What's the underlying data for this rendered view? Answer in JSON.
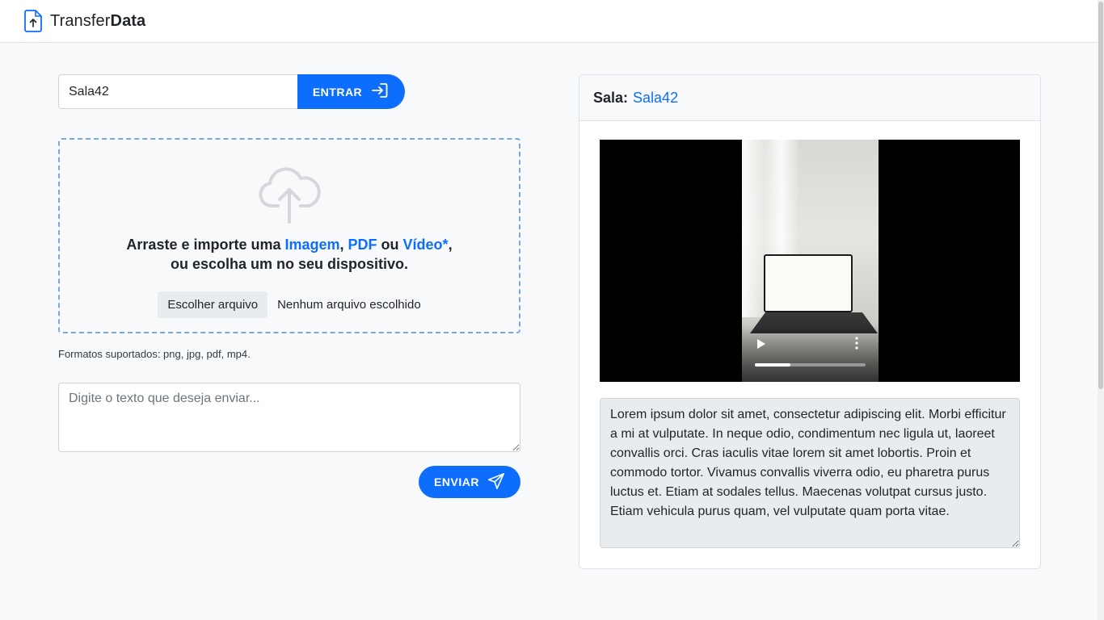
{
  "brand": {
    "light": "Transfer",
    "bold": "Data",
    "icon": "file-upload-icon"
  },
  "room_form": {
    "value": "Sala42",
    "enter_label": "ENTRAR"
  },
  "dropzone": {
    "line1_prefix": "Arraste e importe uma ",
    "types": [
      "Imagem",
      "PDF",
      "Vídeo*"
    ],
    "sep1": ", ",
    "sep2": " ou ",
    "line1_suffix": ",",
    "line2": "ou escolha um no seu dispositivo.",
    "file_button": "Escolher arquivo",
    "file_status": "Nenhum arquivo escolhido"
  },
  "formats_text": "Formatos suportados: png, jpg, pdf, mp4.",
  "text_input": {
    "placeholder": "Digite o texto que deseja enviar..."
  },
  "send_label": "ENVIAR",
  "room_card": {
    "label": "Sala:",
    "room_name": "Sala42",
    "video": {
      "progress": 0.32
    },
    "message": "Lorem ipsum dolor sit amet, consectetur adipiscing elit. Morbi efficitur a mi at vulputate. In neque odio, condimentum nec ligula ut, laoreet convallis orci. Cras iaculis vitae lorem sit amet lobortis. Proin et commodo tortor. Vivamus convallis viverra odio, eu pharetra purus luctus et. Etiam at sodales tellus. Maecenas volutpat cursus justo. Etiam vehicula purus quam, vel vulputate quam porta vitae."
  },
  "colors": {
    "primary": "#0d6efd",
    "background": "#f8f9fa"
  }
}
